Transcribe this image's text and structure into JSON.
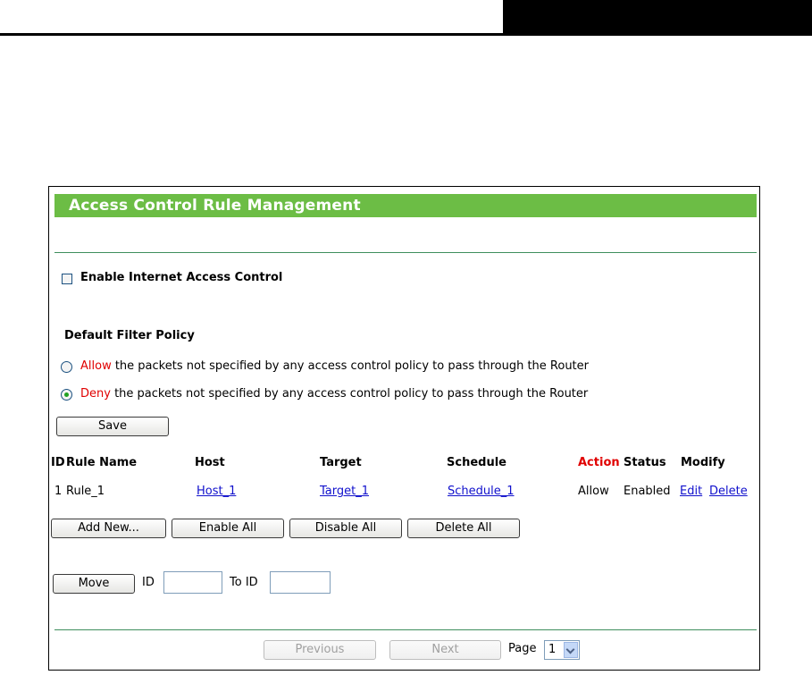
{
  "panel": {
    "title": "Access Control Rule Management",
    "enable_label": "Enable Internet Access Control",
    "enable_checked": false
  },
  "policy": {
    "heading": "Default Filter Policy",
    "allow_keyword": "Allow",
    "allow_rest": " the packets not specified by any access control policy to pass through the Router",
    "deny_keyword": "Deny",
    "deny_rest": " the packets not specified by any access control policy to pass through the Router",
    "selected": "Deny",
    "save_label": "Save"
  },
  "table": {
    "headers": {
      "id": "ID",
      "rule_name": "Rule Name",
      "host": "Host",
      "target": "Target",
      "schedule": "Schedule",
      "action": "Action",
      "status": "Status",
      "modify": "Modify"
    },
    "rows": [
      {
        "id": "1",
        "rule_name": "Rule_1",
        "host": "Host_1",
        "target": "Target_1",
        "schedule": "Schedule_1",
        "action": "Allow",
        "status": "Enabled",
        "edit": "Edit",
        "delete": "Delete"
      }
    ]
  },
  "actions": {
    "add_new": "Add New...",
    "enable_all": "Enable All",
    "disable_all": "Disable All",
    "delete_all": "Delete All"
  },
  "move": {
    "button": "Move",
    "id_label": "ID",
    "to_id_label": "To ID",
    "id_value": "",
    "to_id_value": ""
  },
  "pagination": {
    "previous": "Previous",
    "next": "Next",
    "page_label": "Page",
    "page_value": "1"
  },
  "colors": {
    "title_bar": "#6cbd45",
    "divider": "#3f8f5d",
    "keyword_red": "#e00000",
    "link_blue": "#1010cc"
  }
}
